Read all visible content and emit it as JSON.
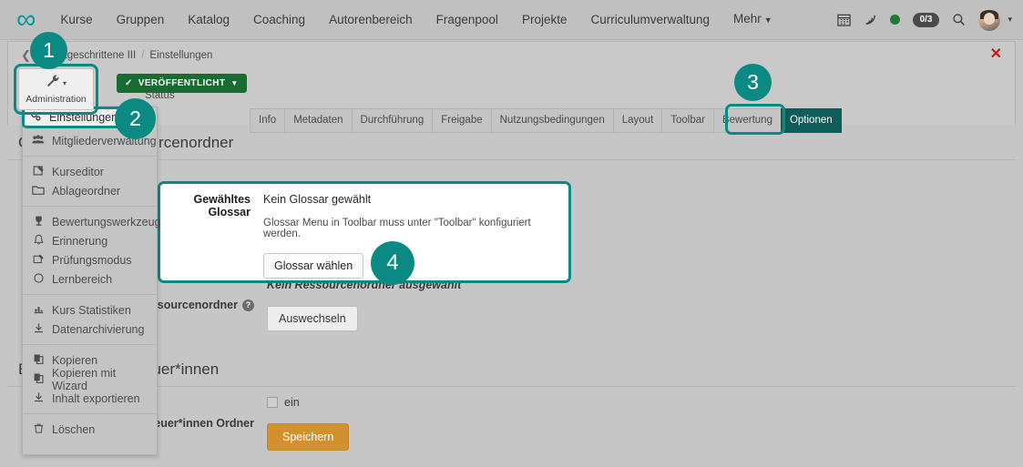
{
  "navbar": {
    "logo": "∞",
    "links": [
      {
        "label": "Kurse",
        "caret": false
      },
      {
        "label": "Gruppen",
        "caret": false
      },
      {
        "label": "Katalog",
        "caret": false
      },
      {
        "label": "Coaching",
        "caret": false
      },
      {
        "label": "Autorenbereich",
        "caret": false
      },
      {
        "label": "Fragenpool",
        "caret": false
      },
      {
        "label": "Projekte",
        "caret": false
      },
      {
        "label": "Curriculumverwaltung",
        "caret": false
      },
      {
        "label": "Mehr",
        "caret": true
      }
    ],
    "right": {
      "calendar_icon": "calendar-icon",
      "rss_icon": "rss-icon",
      "status_dot": "online-dot",
      "task_count": "0/3",
      "search_icon": "search-icon",
      "avatar": "user-avatar",
      "avatar_caret": "▾"
    }
  },
  "panel": {
    "breadcrumb": {
      "back": "❮",
      "course": "ür Fortgeschrittene III",
      "separator": "/",
      "current": "Einstellungen"
    },
    "close": "✕",
    "status_badge": {
      "check": "✓",
      "label": "VERÖFFENTLICHT",
      "caret": "▼"
    },
    "status_caption": "Status",
    "admin_button": {
      "icon": "wrench-icon",
      "caret": "▾",
      "label": "Administration"
    }
  },
  "dropdown": {
    "groups": [
      [
        {
          "icon": "gears-icon",
          "glyph": "⚙",
          "label": "Einstellungen",
          "highlighted": true
        },
        {
          "icon": "users-icon",
          "glyph": "👥",
          "label": "Mitgliederverwaltung",
          "highlighted": false
        }
      ],
      [
        {
          "icon": "edit-icon",
          "glyph": "✎",
          "label": "Kurseditor",
          "highlighted": false
        },
        {
          "icon": "folder-icon",
          "glyph": "🗀",
          "label": "Ablageordner",
          "highlighted": false
        }
      ],
      [
        {
          "icon": "trophy-icon",
          "glyph": "🏆",
          "label": "Bewertungswerkzeug",
          "highlighted": false
        },
        {
          "icon": "bell-icon",
          "glyph": "🔔",
          "label": "Erinnerung",
          "highlighted": false
        },
        {
          "icon": "exam-icon",
          "glyph": "🗒",
          "label": "Prüfungsmodus",
          "highlighted": false
        },
        {
          "icon": "circle-icon",
          "glyph": "◯",
          "label": "Lernbereich",
          "highlighted": false
        }
      ],
      [
        {
          "icon": "chart-icon",
          "glyph": "▥",
          "label": "Kurs Statistiken",
          "highlighted": false
        },
        {
          "icon": "download-icon",
          "glyph": "⤓",
          "label": "Datenarchivierung",
          "highlighted": false
        }
      ],
      [
        {
          "icon": "copy-icon",
          "glyph": "⧉",
          "label": "Kopieren",
          "highlighted": false
        },
        {
          "icon": "copy-icon",
          "glyph": "⧉",
          "label": "Kopieren mit Wizard",
          "highlighted": false
        },
        {
          "icon": "export-icon",
          "glyph": "⤓",
          "label": "Inhalt exportieren",
          "highlighted": false
        }
      ],
      [
        {
          "icon": "trash-icon",
          "glyph": "🗑",
          "label": "Löschen",
          "highlighted": false
        }
      ]
    ]
  },
  "tabs": [
    {
      "label": "Info",
      "active": false
    },
    {
      "label": "Metadaten",
      "active": false
    },
    {
      "label": "Durchführung",
      "active": false
    },
    {
      "label": "Freigabe",
      "active": false
    },
    {
      "label": "Nutzungsbedingungen",
      "active": false
    },
    {
      "label": "Layout",
      "active": false
    },
    {
      "label": "Toolbar",
      "active": false
    },
    {
      "label": "Bewertung",
      "active": false
    },
    {
      "label": "Optionen",
      "active": true
    }
  ],
  "main": {
    "section1_title_prefix": "G",
    "section1_title_suffix": "rcenordner",
    "glossar": {
      "label": "Gewähltes Glossar",
      "value": "Kein Glossar gewählt",
      "hint": "Glossar Menu in Toolbar muss unter \"Toolbar\" konfiguriert werden.",
      "button": "Glossar wählen"
    },
    "ressourcenordner": {
      "label": "Ressourcenordner",
      "help": "?",
      "value": "Kein Ressourcenordner ausgewählt",
      "button": "Auswechseln"
    },
    "section2_title_prefix": "E",
    "section2_title_suffix": "uer*innen",
    "betreuer": {
      "label": "reuer*innen Ordner",
      "checkbox_label": "ein",
      "checked": false
    },
    "save_button": "Speichern"
  },
  "steps": [
    {
      "id": "step1",
      "number": "1"
    },
    {
      "id": "step2",
      "number": "2"
    },
    {
      "id": "step3",
      "number": "3"
    },
    {
      "id": "step4",
      "number": "4"
    }
  ],
  "colors": {
    "accent_teal": "#0b8a84",
    "tab_active": "#0e5d58",
    "publish_green": "#1a6b31",
    "save_orange": "#d2912f",
    "close_red": "#c01a1a",
    "page_bg": "#c6c6c6"
  }
}
